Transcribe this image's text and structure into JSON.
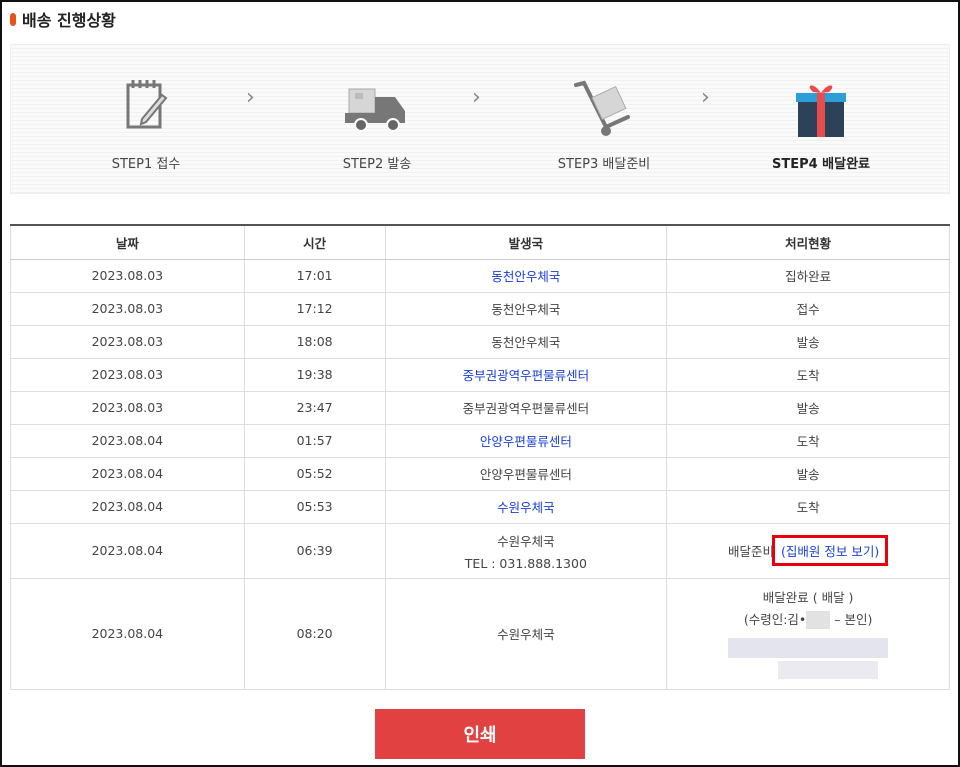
{
  "page": {
    "title": "배송 진행상황",
    "accent_color": "#e8531a"
  },
  "steps": [
    {
      "label": "STEP1 접수",
      "icon": "clipboard-icon",
      "active": false
    },
    {
      "label": "STEP2 발송",
      "icon": "truck-icon",
      "active": false
    },
    {
      "label": "STEP3 배달준비",
      "icon": "hand-truck-icon",
      "active": false
    },
    {
      "label": "STEP4 배달완료",
      "icon": "gift-icon",
      "active": true
    }
  ],
  "step_separator": "›",
  "table": {
    "headers": [
      "날짜",
      "시간",
      "발생국",
      "처리현황"
    ],
    "rows": [
      {
        "date": "2023.08.03",
        "time": "17:01",
        "office": "동천안우체국",
        "office_link": true,
        "status": "집하완료"
      },
      {
        "date": "2023.08.03",
        "time": "17:12",
        "office": "동천안우체국",
        "office_link": false,
        "status": "접수"
      },
      {
        "date": "2023.08.03",
        "time": "18:08",
        "office": "동천안우체국",
        "office_link": false,
        "status": "발송"
      },
      {
        "date": "2023.08.03",
        "time": "19:38",
        "office": "중부권광역우편물류센터",
        "office_link": true,
        "status": "도착"
      },
      {
        "date": "2023.08.03",
        "time": "23:47",
        "office": "중부권광역우편물류센터",
        "office_link": false,
        "status": "발송"
      },
      {
        "date": "2023.08.04",
        "time": "01:57",
        "office": "안양우편물류센터",
        "office_link": true,
        "status": "도착"
      },
      {
        "date": "2023.08.04",
        "time": "05:52",
        "office": "안양우편물류센터",
        "office_link": false,
        "status": "발송"
      },
      {
        "date": "2023.08.04",
        "time": "05:53",
        "office": "수원우체국",
        "office_link": true,
        "status": "도착"
      },
      {
        "date": "2023.08.04",
        "time": "06:39",
        "office": "수원우체국",
        "office_tel": "TEL : 031.888.1300",
        "status": "배달준비",
        "status_link": "(집배원 정보 보기)"
      },
      {
        "date": "2023.08.04",
        "time": "08:20",
        "office": "수원우체국",
        "status": "배달완료 ( 배달 )",
        "recipient_prefix": "(수령인:김•",
        "recipient_suffix": "– 본인)"
      }
    ]
  },
  "print_button": "인쇄"
}
